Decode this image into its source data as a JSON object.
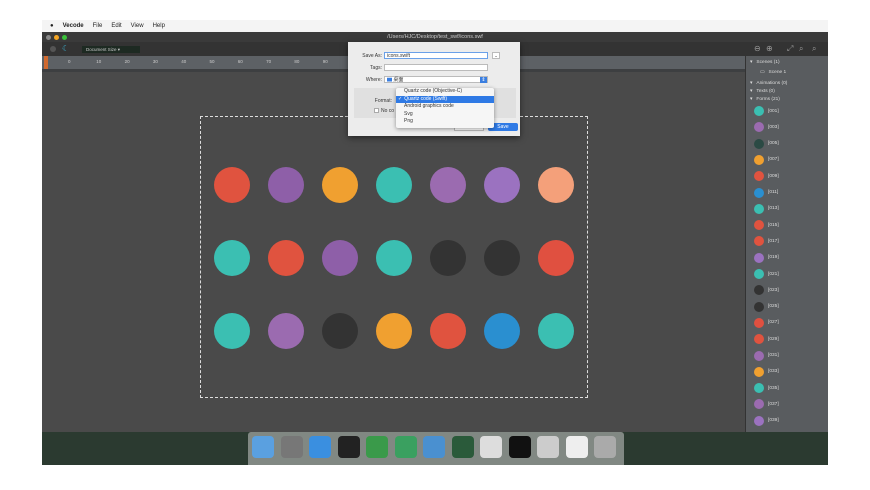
{
  "menubar": {
    "app": "Vecode",
    "items": [
      "File",
      "Edit",
      "View",
      "Help"
    ]
  },
  "window": {
    "title": "/Users/HJC/Desktop/test_swf/icons.swf"
  },
  "toolbar": {
    "zoom_select": "Document Size"
  },
  "ruler": {
    "ticks": [
      "0",
      "10",
      "20",
      "30",
      "40",
      "50",
      "60",
      "70",
      "80",
      "90",
      "100",
      "110",
      "120"
    ]
  },
  "dialog": {
    "save_as_label": "Save As:",
    "save_as_value": "icons.swift",
    "tags_label": "Tags:",
    "tags_value": "",
    "where_label": "Where:",
    "where_value": "桌面",
    "format_label": "Format:",
    "no_color_label": "No co",
    "cancel": "Cancel",
    "save": "Save"
  },
  "format_menu": {
    "options": [
      "Quartz code (Objective-C)",
      "Quartz code (Swift)",
      "Android graphics code",
      "Svg",
      "Png"
    ],
    "selected": "Quartz code (Swift)",
    "accent": "#2f7ae5"
  },
  "panel": {
    "scenes": "Scenes (1)",
    "scene1": "Scene 1",
    "animations": "Animations (0)",
    "texts": "Texts (0)",
    "forms": "Forms (21)",
    "layers": [
      "[001]",
      "[003]",
      "[005]",
      "[007]",
      "[009]",
      "[011]",
      "[013]",
      "[015]",
      "[017]",
      "[019]",
      "[021]",
      "[023]",
      "[025]",
      "[027]",
      "[029]",
      "[031]",
      "[033]",
      "[035]",
      "[037]",
      "[039]",
      "[041]"
    ]
  },
  "icons": {
    "colors": [
      [
        "#e0533f",
        "#8e5fa8",
        "#f0a030",
        "#3bbfb2",
        "#9b6bb0",
        "#9b72c0",
        "#f4a07a"
      ],
      [
        "#3bbfb2",
        "#e0533f",
        "#8e5fa8",
        "#3bbfb2",
        "#333333",
        "#333333",
        "#e05040"
      ],
      [
        "#3bbfb2",
        "#9b6bb0",
        "#333333",
        "#f0a030",
        "#e0533f",
        "#2a8fd0",
        "#3bbfb2"
      ]
    ]
  }
}
